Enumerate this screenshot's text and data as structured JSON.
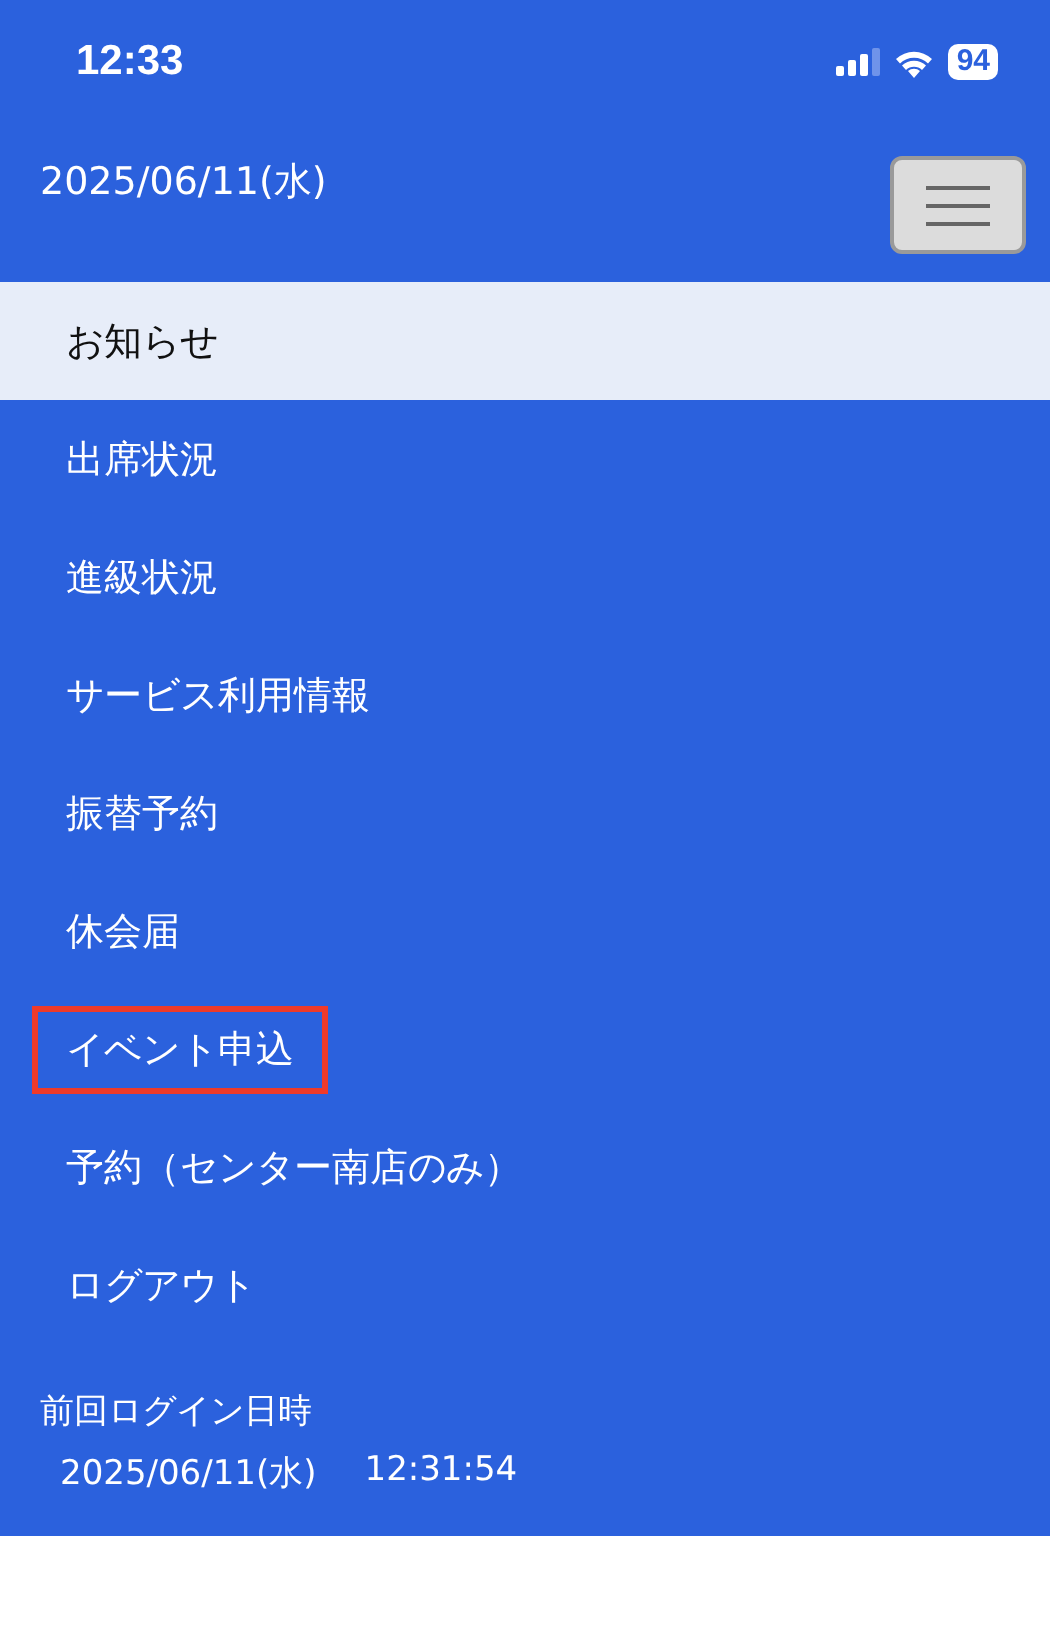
{
  "status_bar": {
    "time": "12:33",
    "battery": "94"
  },
  "header": {
    "date": "2025/06/11(水)"
  },
  "menu": [
    {
      "label": "お知らせ",
      "selected": true,
      "highlighted": false
    },
    {
      "label": "出席状況",
      "selected": false,
      "highlighted": false
    },
    {
      "label": "進級状況",
      "selected": false,
      "highlighted": false
    },
    {
      "label": "サービス利用情報",
      "selected": false,
      "highlighted": false
    },
    {
      "label": "振替予約",
      "selected": false,
      "highlighted": false
    },
    {
      "label": "休会届",
      "selected": false,
      "highlighted": false
    },
    {
      "label": "イベント申込",
      "selected": false,
      "highlighted": true
    },
    {
      "label": "予約（センター南店のみ）",
      "selected": false,
      "highlighted": false
    },
    {
      "label": "ログアウト",
      "selected": false,
      "highlighted": false
    }
  ],
  "last_login": {
    "label": "前回ログイン日時",
    "date": "2025/06/11(水)",
    "time": "12:31:54"
  }
}
